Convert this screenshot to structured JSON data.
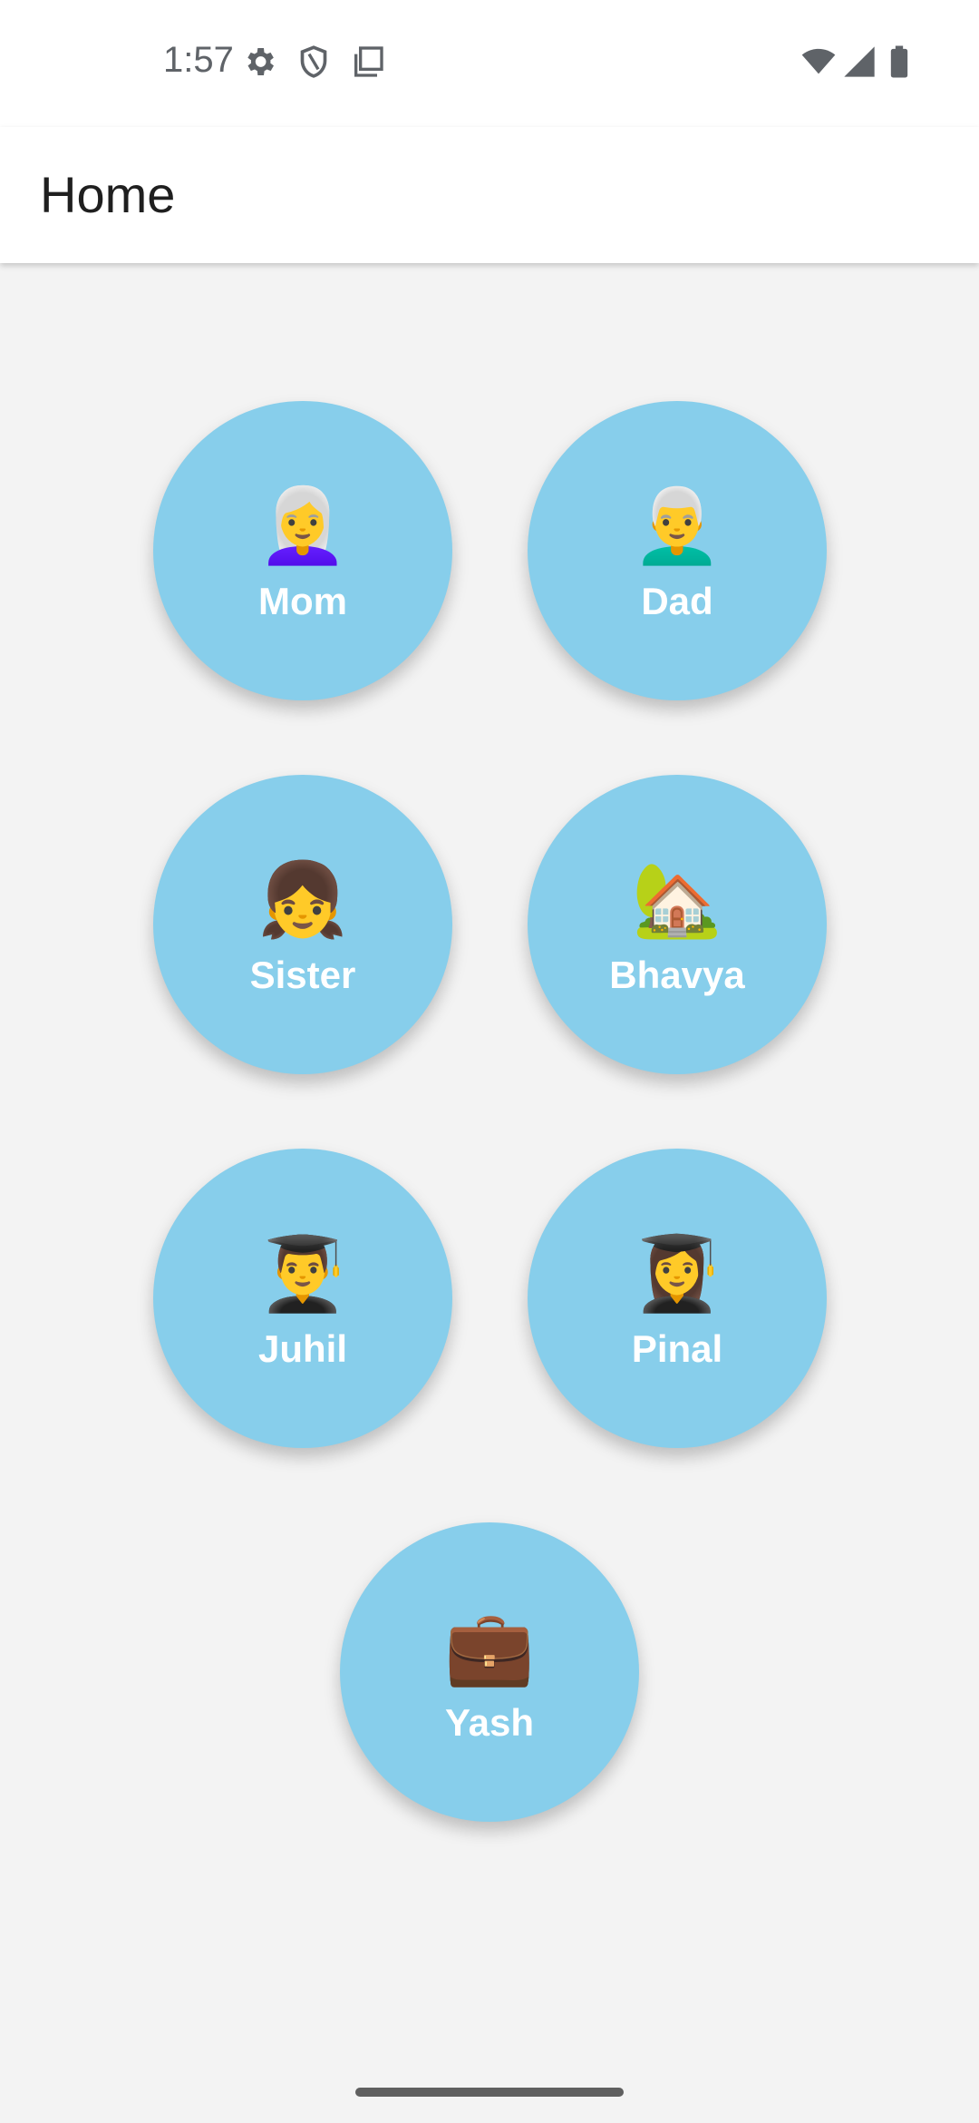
{
  "status_bar": {
    "time": "1:57",
    "icons_left": [
      "gear-icon",
      "shield-icon",
      "copy-icon"
    ],
    "icons_right": [
      "wifi-icon",
      "signal-icon",
      "battery-icon"
    ]
  },
  "app_bar": {
    "title": "Home"
  },
  "buttons": [
    {
      "label": "Mom",
      "emoji": "👩‍🦳",
      "icon": "old-woman-icon"
    },
    {
      "label": "Dad",
      "emoji": "👨‍🦳",
      "icon": "old-man-icon"
    },
    {
      "label": "Sister",
      "emoji": "👧",
      "icon": "girl-icon"
    },
    {
      "label": "Bhavya",
      "emoji": "🏡",
      "icon": "house-icon"
    },
    {
      "label": "Juhil",
      "emoji": "👨‍🎓",
      "icon": "male-graduate-icon"
    },
    {
      "label": "Pinal",
      "emoji": "👩‍🎓",
      "icon": "female-graduate-icon"
    },
    {
      "label": "Yash",
      "emoji": "💼",
      "icon": "briefcase-icon"
    }
  ],
  "colors": {
    "button_fill": "#87ceeb",
    "background": "#f3f3f3",
    "app_bar": "#ffffff"
  }
}
